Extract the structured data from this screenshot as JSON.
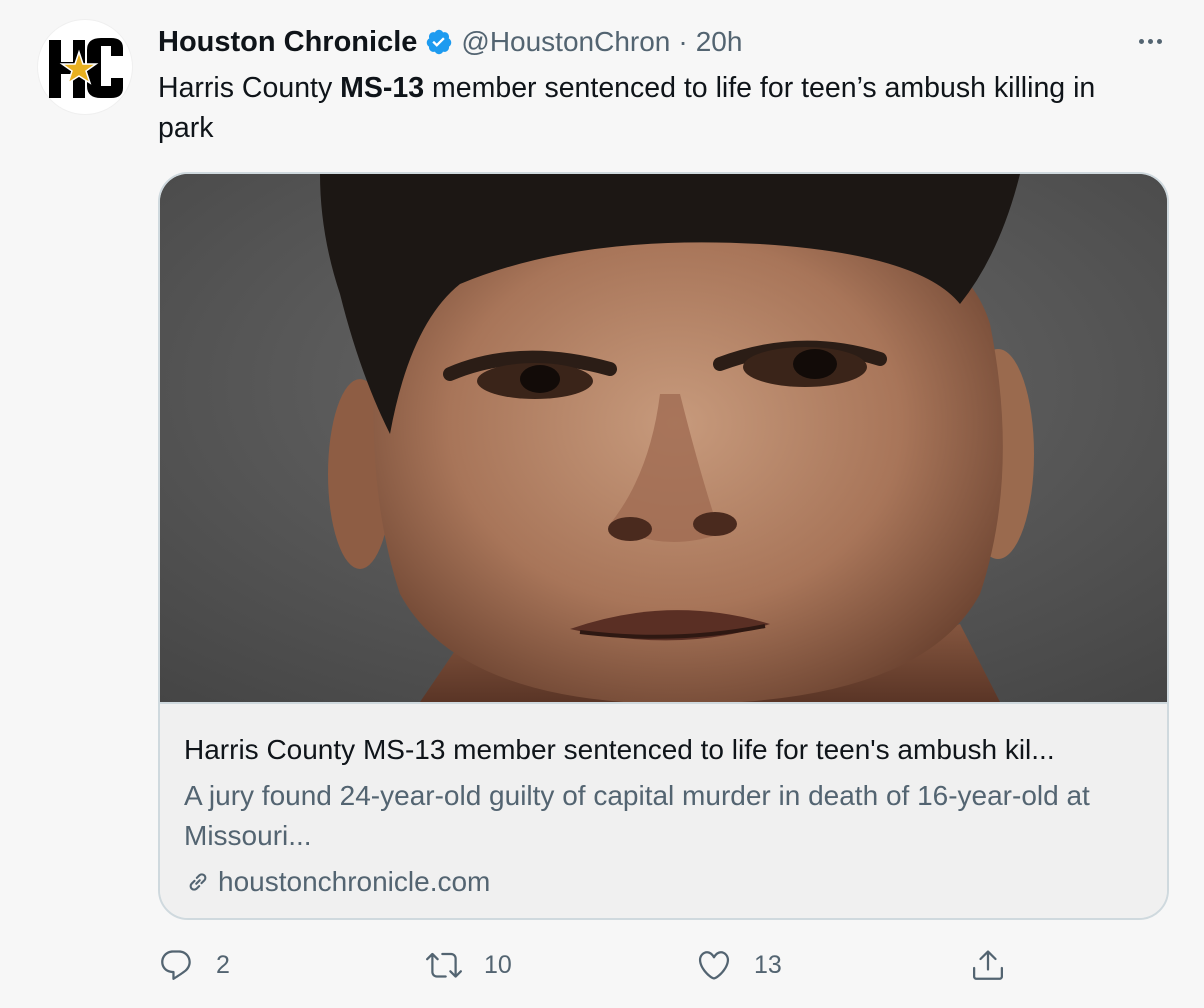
{
  "tweet": {
    "display_name": "Houston Chronicle",
    "handle": "@HoustonChron",
    "separator": "·",
    "time": "20h",
    "text_before": "Harris County ",
    "text_bold": "MS-13",
    "text_after": " member sentenced to life for teen’s ambush killing in park",
    "verified_color": "#1d9bf0"
  },
  "avatar": {
    "logo_text": "HC",
    "logo_colors": {
      "letters": "#000000",
      "star": "#e8b020",
      "background": "#ffffff"
    }
  },
  "card": {
    "image_description_icon": "photo",
    "title": "Harris County MS-13 member sentenced to life for teen's ambush kil...",
    "description": "A jury found 24-year-old guilty of capital murder in death of 16-year-old at Missouri...",
    "domain": "houstonchronicle.com",
    "link_icon": "link-icon"
  },
  "actions": {
    "reply_count": "2",
    "retweet_count": "10",
    "like_count": "13",
    "icons": [
      "reply-icon",
      "retweet-icon",
      "like-icon",
      "share-icon"
    ]
  },
  "colors": {
    "background": "#f7f7f7",
    "text_primary": "#0f1419",
    "text_secondary": "#536471",
    "border": "#cfd9de",
    "accent": "#1d9bf0"
  }
}
